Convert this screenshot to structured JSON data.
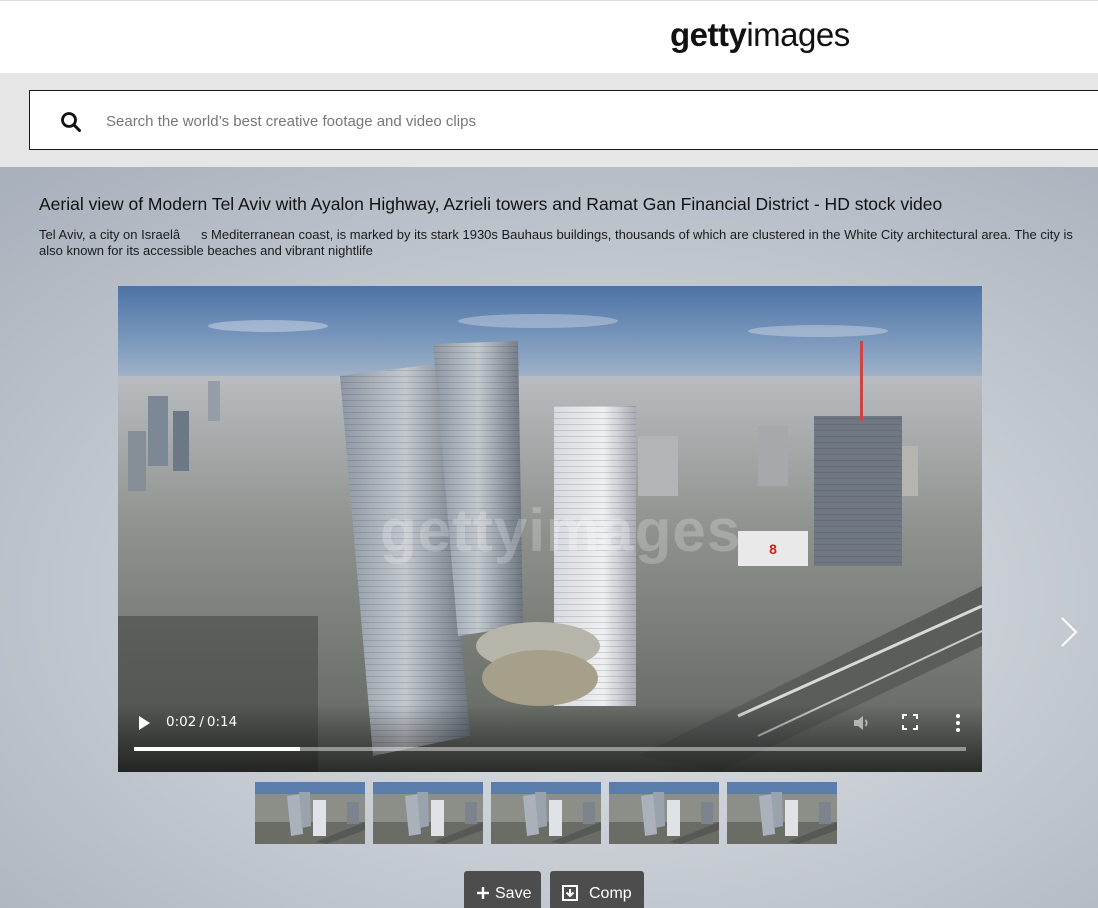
{
  "header": {
    "logo_bold": "getty",
    "logo_regular": "images"
  },
  "search": {
    "placeholder": "Search the world’s best creative footage and video clips",
    "value": ""
  },
  "main": {
    "title": "Aerial view of Modern Tel Aviv with Ayalon Highway, Azrieli towers and Ramat Gan Financial District - HD stock video",
    "description": "Tel Aviv, a city on Israelâs Mediterranean coast, is marked by its stark 1930s Bauhaus buildings, thousands of which are clustered in the White City architectural area. The city is also known for its accessible beaches and vibrant nightlife"
  },
  "video": {
    "current_time": "0:02",
    "separator": "/",
    "duration": "0:14",
    "progress": 0.2,
    "watermark": "gettyimages"
  },
  "thumbnails": {
    "count": 5
  },
  "actions": {
    "save_label": "Save",
    "comp_label": "Comp"
  },
  "icons": {
    "search": "search-icon",
    "play": "play-icon",
    "volume": "volume-icon",
    "fullscreen": "fullscreen-icon",
    "menu": "more-vertical-icon",
    "next": "chevron-right-icon",
    "save": "plus-icon",
    "comp": "download-icon"
  }
}
